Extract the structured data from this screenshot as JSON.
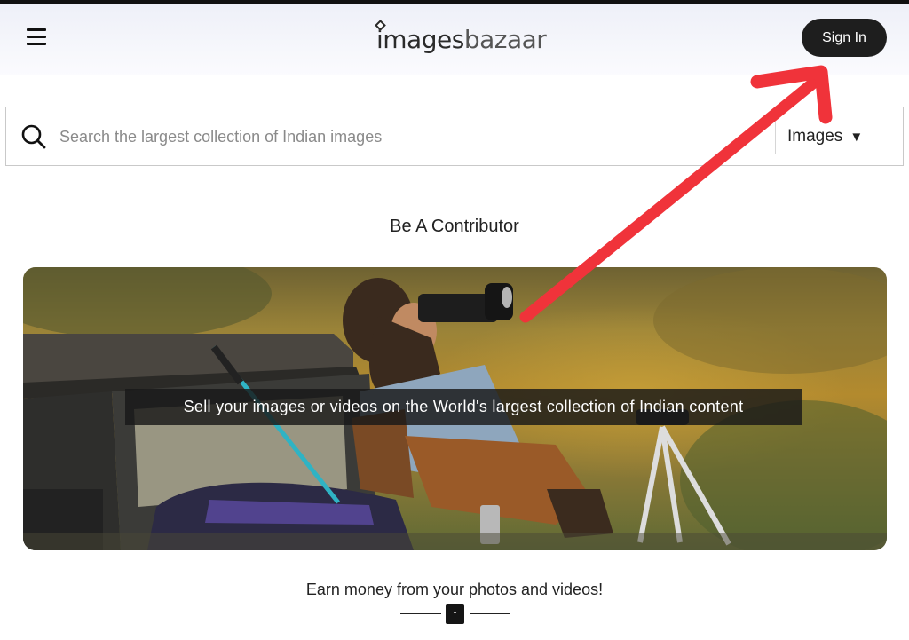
{
  "header": {
    "logo_part1": "images",
    "logo_part2": "bazaar",
    "signin_label": "Sign In"
  },
  "search": {
    "placeholder": "Search the largest collection of Indian images",
    "value": "",
    "type_selected": "Images",
    "caret": "▼"
  },
  "contributor": {
    "title": "Be A Contributor",
    "banner_caption": "Sell your images or videos on the World's largest collection of Indian content",
    "earn_text": "Earn money from your photos and videos!",
    "up_glyph": "↑"
  },
  "annotation": {
    "arrow_color": "#f0333a"
  },
  "icons": [
    "menu-icon",
    "search-icon",
    "caret-down-icon",
    "arrow-up-icon"
  ]
}
